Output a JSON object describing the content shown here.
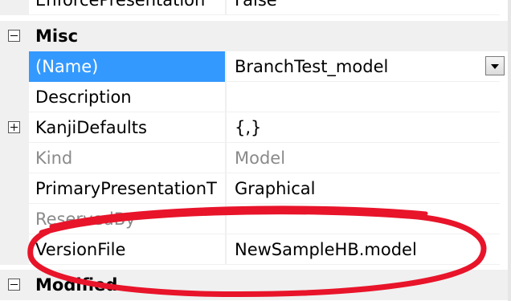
{
  "colors": {
    "selection": "#3399ff",
    "gutter": "#f0f0f0",
    "annotation": "#e8142a",
    "readonly_text": "#8a8a8a"
  },
  "rows": {
    "enforce_presentation": {
      "name": "EnforcePresentation",
      "value": "False"
    },
    "misc_category": {
      "label": "Misc",
      "expander_icon": "collapse-minus-icon"
    },
    "name_prop": {
      "name": "(Name)",
      "value": "BranchTest_model",
      "dropdown_icon": "dropdown-arrow-icon"
    },
    "description": {
      "name": "Description",
      "value": ""
    },
    "kanji_defaults": {
      "name": "KanjiDefaults",
      "value": "{,}",
      "expander_icon": "expand-plus-icon"
    },
    "kind": {
      "name": "Kind",
      "value": "Model"
    },
    "primary_presentation": {
      "name": "PrimaryPresentationT",
      "value": "Graphical"
    },
    "reserved_by": {
      "name": "ReservedBy",
      "value": ""
    },
    "version_file": {
      "name": "VersionFile",
      "value": "NewSampleHB.model"
    },
    "modified_category": {
      "label": "Modified",
      "expander_icon": "collapse-minus-icon"
    }
  }
}
